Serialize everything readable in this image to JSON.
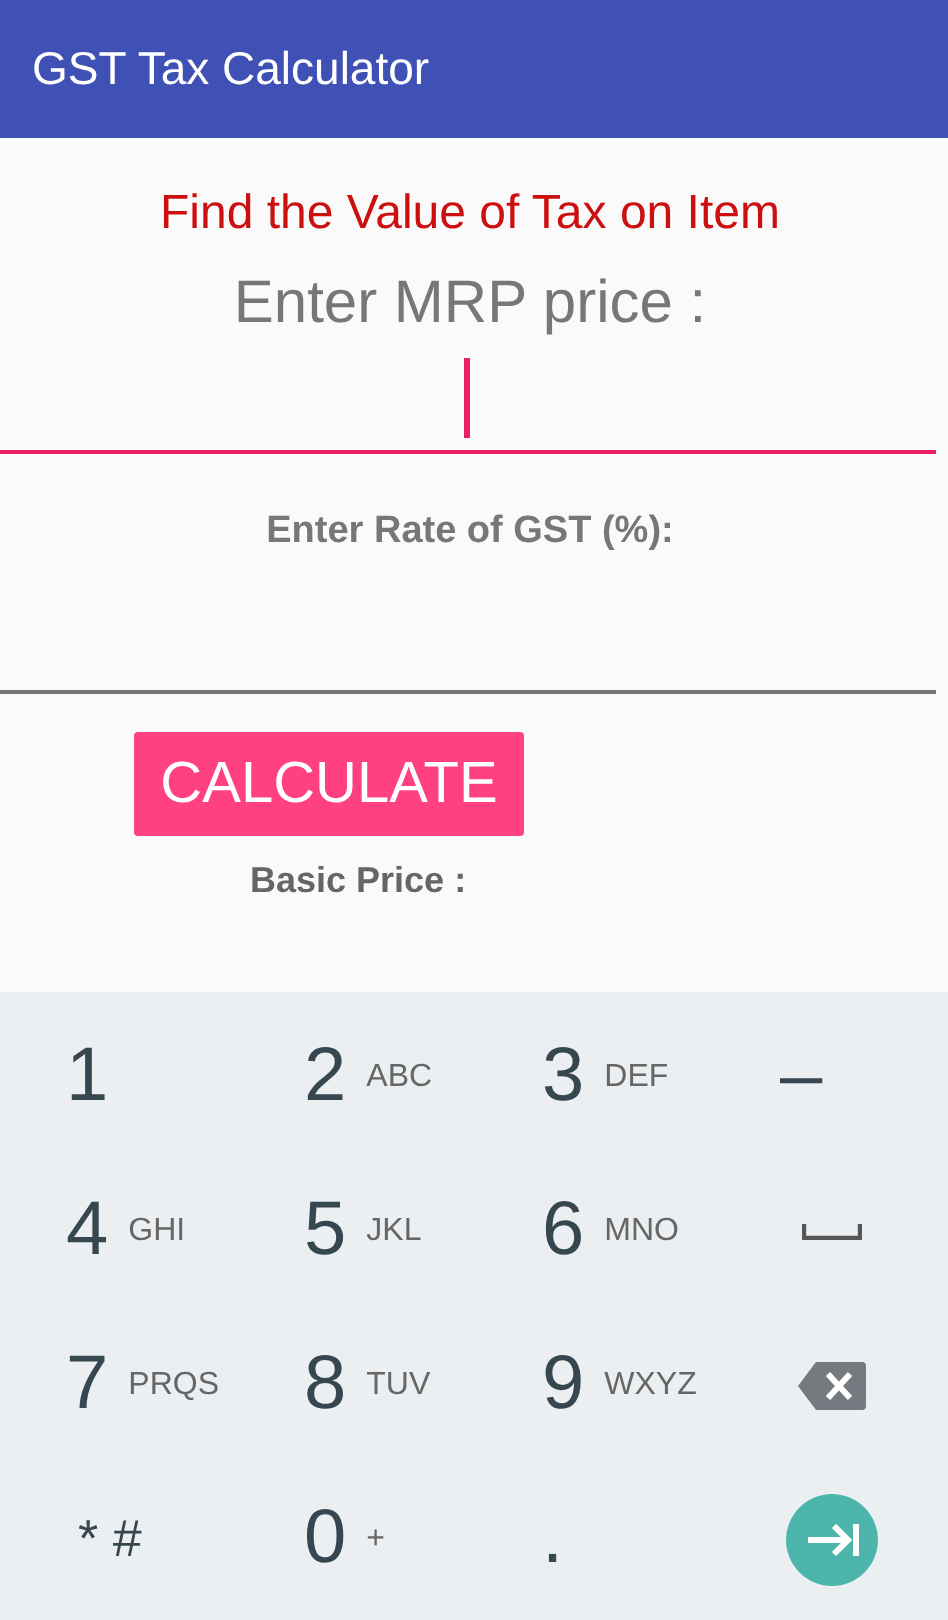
{
  "app_bar": {
    "title": "GST Tax Calculator"
  },
  "heading": "Find the Value of Tax on Item",
  "fields": [
    {
      "label": "Enter MRP price :",
      "kind": "large",
      "focused": true
    },
    {
      "label": "Enter Rate of GST (%):",
      "kind": "bold",
      "focused": false
    }
  ],
  "calculate_button": "CALCULATE",
  "result_label": "Basic Price :",
  "keypad": [
    [
      {
        "kind": "char",
        "main": "1"
      },
      {
        "kind": "char",
        "main": "2",
        "sub": "ABC"
      },
      {
        "kind": "char",
        "main": "3",
        "sub": "DEF"
      },
      {
        "kind": "char",
        "main": "–"
      }
    ],
    [
      {
        "kind": "char",
        "main": "4",
        "sub": "GHI"
      },
      {
        "kind": "char",
        "main": "5",
        "sub": "JKL"
      },
      {
        "kind": "char",
        "main": "6",
        "sub": "MNO"
      },
      {
        "kind": "space"
      }
    ],
    [
      {
        "kind": "char",
        "main": "7",
        "sub": "PRQS"
      },
      {
        "kind": "char",
        "main": "8",
        "sub": "TUV"
      },
      {
        "kind": "char",
        "main": "9",
        "sub": "WXYZ"
      },
      {
        "kind": "backspace"
      }
    ],
    [
      {
        "kind": "symbol",
        "main": "* #"
      },
      {
        "kind": "char",
        "main": "0",
        "sub": "+"
      },
      {
        "kind": "char",
        "main": "."
      },
      {
        "kind": "next"
      }
    ]
  ]
}
